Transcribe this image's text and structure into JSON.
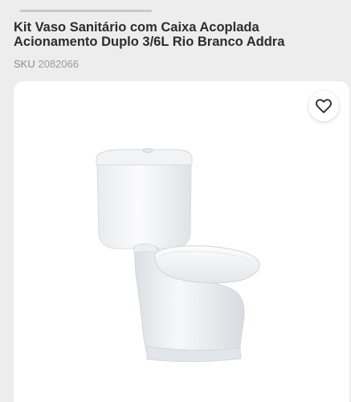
{
  "product": {
    "title": "Kit Vaso Sanitário com Caixa Acoplada Acionamento Duplo 3/6L Rio Branco Addra",
    "sku_label": "SKU",
    "sku_value": "2082066"
  },
  "image": {
    "alt": "Kit Vaso Sanitário com Caixa Acoplada"
  },
  "favorite": {
    "icon": "heart-icon"
  }
}
